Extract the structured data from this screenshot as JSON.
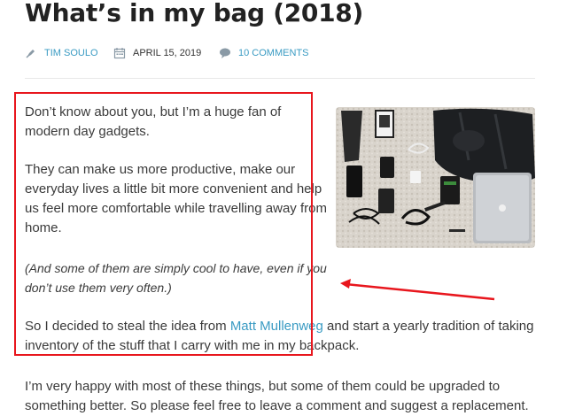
{
  "post": {
    "title": "What’s in my bag (2018)",
    "author": "TIM SOULO",
    "date": "APRIL 15, 2019",
    "comments": "10 COMMENTS"
  },
  "icons": {
    "author": "pen-nib-icon",
    "date": "calendar-icon",
    "comments": "speech-bubble-icon"
  },
  "content": {
    "p1_line1": "Don’t know about you, but I’m a huge fan of",
    "p1_line2": "modern day gadgets.",
    "p2_line1": "They can make us more productive, make our",
    "p2_line2": "everyday lives a little bit more convenient and help",
    "p2_line3": "us feel more comfortable while travelling away from",
    "p2_line4": "home.",
    "p3_line1": "(And some of them are simply cool to have, even if you",
    "p3_line2": "don’t use them very often.)",
    "p4_line1_before": "So I decided to steal the idea from ",
    "p4_link": "Matt Mullenweg",
    "p4_line1_after": " and start a yearly tradition of taking",
    "p4_line2": "inventory of the stuff that I carry with me in my backpack.",
    "p5_line1": "I’m very happy with most of these things, but some of them could be upgraded to",
    "p5_line2": "something better. So please feel free to leave a comment and suggest a replacement."
  },
  "annotation": {
    "color": "#e8161d"
  },
  "colors": {
    "link": "#3a9bc3",
    "text": "#3a3a3a",
    "title": "#222222"
  }
}
